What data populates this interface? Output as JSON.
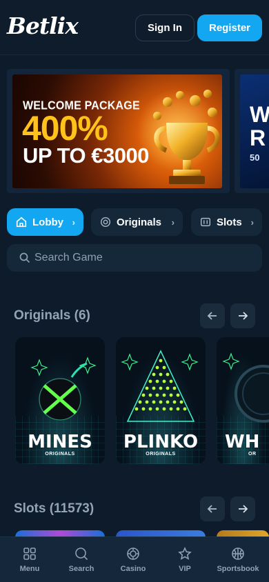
{
  "header": {
    "logo": "Betlix",
    "sign_in": "Sign In",
    "register": "Register"
  },
  "banner": {
    "line1": "WELCOME PACKAGE",
    "line2": "400%",
    "line3": "UP TO €3000"
  },
  "banner_next": {
    "line1": "W",
    "line2": "R",
    "line3": "50"
  },
  "categories": [
    {
      "label": "Lobby",
      "icon": "home-icon",
      "active": true
    },
    {
      "label": "Originals",
      "icon": "originals-icon",
      "active": false
    },
    {
      "label": "Slots",
      "icon": "slots-icon",
      "active": false
    }
  ],
  "search": {
    "placeholder": "Search Game"
  },
  "sections": {
    "originals": {
      "title": "Originals (6)",
      "games": [
        {
          "title": "MINES",
          "subtitle": "ORIGINALS"
        },
        {
          "title": "PLINKO",
          "subtitle": "ORIGINALS"
        },
        {
          "title": "WH",
          "subtitle": "OR"
        }
      ]
    },
    "slots": {
      "title": "Slots (11573)"
    }
  },
  "bottom_nav": [
    {
      "label": "Menu",
      "icon": "grid-icon"
    },
    {
      "label": "Search",
      "icon": "search-icon"
    },
    {
      "label": "Casino",
      "icon": "casino-chip-icon"
    },
    {
      "label": "VIP",
      "icon": "star-icon"
    },
    {
      "label": "Sportsbook",
      "icon": "ball-icon"
    }
  ],
  "colors": {
    "background": "#0e1b2a",
    "accent": "#12a7f0",
    "surface": "#15283a"
  }
}
